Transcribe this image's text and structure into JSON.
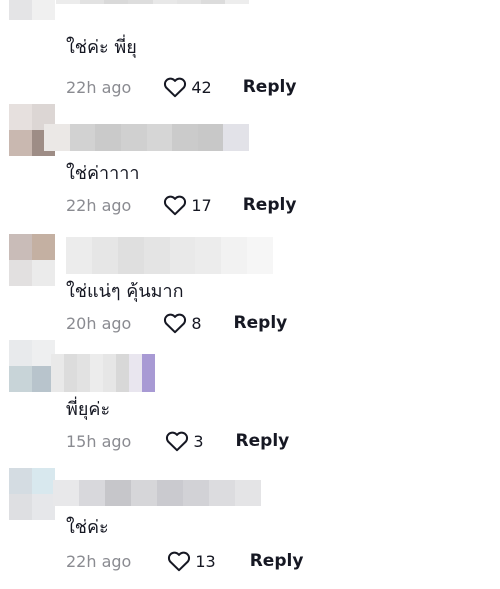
{
  "comments": [
    {
      "text": "ใช่ค่ะ พี่ยุ",
      "timestamp": "22h ago",
      "likes": "42",
      "reply_label": "Reply",
      "avatar_colors": [
        "#d8ccca",
        "#e6e2e2",
        "#e4e4e6",
        "#f0f0f0"
      ],
      "username_colors": [
        "#ececec",
        "#e2e2e2",
        "#d9d9d9",
        "#dddddd",
        "#e8e8e8",
        "#e4e4e4",
        "#dcdcdc",
        "#ededed"
      ]
    },
    {
      "text": "ใช่ค่าาาา",
      "timestamp": "22h ago",
      "likes": "17",
      "reply_label": "Reply",
      "avatar_colors": [
        "#e6e0de",
        "#dcd6d4",
        "#c9b8b0",
        "#9e8d86"
      ],
      "username_colors": [
        "#ebe8e6",
        "#d2d2d2",
        "#cacaca",
        "#d0d0d0",
        "#d6d6d6",
        "#cbcbcb",
        "#c8c8c8",
        "#e2e2e8"
      ]
    },
    {
      "text": "ใช่แน่ๆ คุ้นมาก",
      "timestamp": "20h ago",
      "likes": "8",
      "reply_label": "Reply",
      "avatar_colors": [
        "#c9bcb8",
        "#c4b0a2",
        "#e2e0e0",
        "#ebebeb"
      ],
      "username_colors": [
        "#ececec",
        "#e6e6e6",
        "#dfdfdf",
        "#e4e4e4",
        "#e9e9e9",
        "#ececec",
        "#f2f2f2",
        "#f6f6f6"
      ]
    },
    {
      "text": "พี่ยุค่ะ",
      "timestamp": "15h ago",
      "likes": "3",
      "reply_label": "Reply",
      "avatar_colors": [
        "#e8eaec",
        "#eeeff0",
        "#c8d4d8",
        "#b8c4cc"
      ],
      "username_colors": [
        "#e9e9e9",
        "#dcdcdc",
        "#e2e2e2",
        "#ececec",
        "#e6e6e6",
        "#d8d8d8",
        "#e9e6ef",
        "#a89ad4"
      ]
    },
    {
      "text": "ใช่ค่ะ",
      "timestamp": "22h ago",
      "likes": "13",
      "reply_label": "Reply",
      "avatar_colors": [
        "#d4dce2",
        "#d8e8ee",
        "#dedfe2",
        "#e6e7ea"
      ],
      "username_colors": [
        "#e8e8ea",
        "#d8d8dc",
        "#c6c6ca",
        "#d6d6d9",
        "#cacacf",
        "#d2d2d6",
        "#dcdcdf",
        "#e4e4e6"
      ]
    }
  ]
}
